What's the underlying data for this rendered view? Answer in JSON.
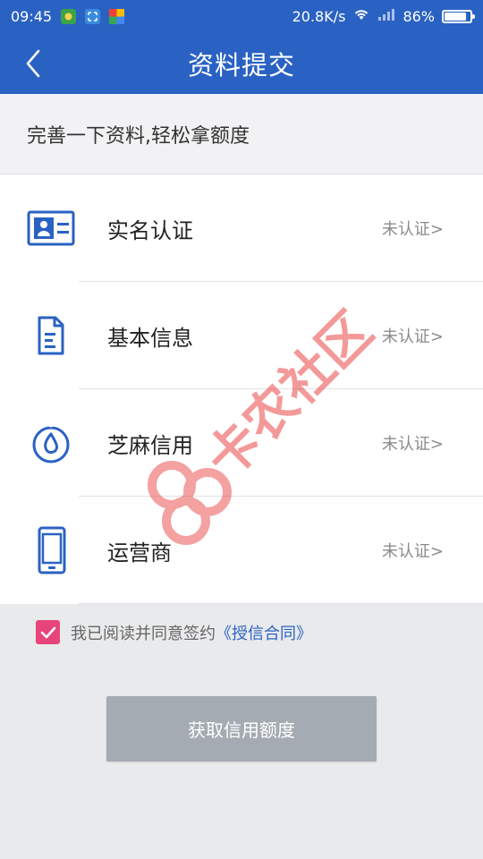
{
  "status_bar": {
    "time": "09:45",
    "network_speed": "20.8K/s",
    "battery_percent_label": "86%",
    "battery_level": 0.86
  },
  "header": {
    "title": "资料提交"
  },
  "subheader": {
    "text": "完善一下资料,轻松拿额度"
  },
  "items": [
    {
      "label": "实名认证",
      "status": "未认证>",
      "icon": "id-card-icon"
    },
    {
      "label": "基本信息",
      "status": "未认证>",
      "icon": "document-icon"
    },
    {
      "label": "芝麻信用",
      "status": "未认证>",
      "icon": "sesame-credit-icon"
    },
    {
      "label": "运营商",
      "status": "未认证>",
      "icon": "mobile-phone-icon"
    }
  ],
  "agreement": {
    "text": "我已阅读并同意签约",
    "link_text": "《授信合同》",
    "checked": true
  },
  "submit_button": {
    "label": "获取信用额度"
  },
  "watermark": {
    "text": "卡农社区"
  },
  "colors": {
    "primary": "#2a62c3",
    "checkbox": "#e8447c",
    "button_disabled": "#a5abb3",
    "watermark": "#eb4646"
  }
}
